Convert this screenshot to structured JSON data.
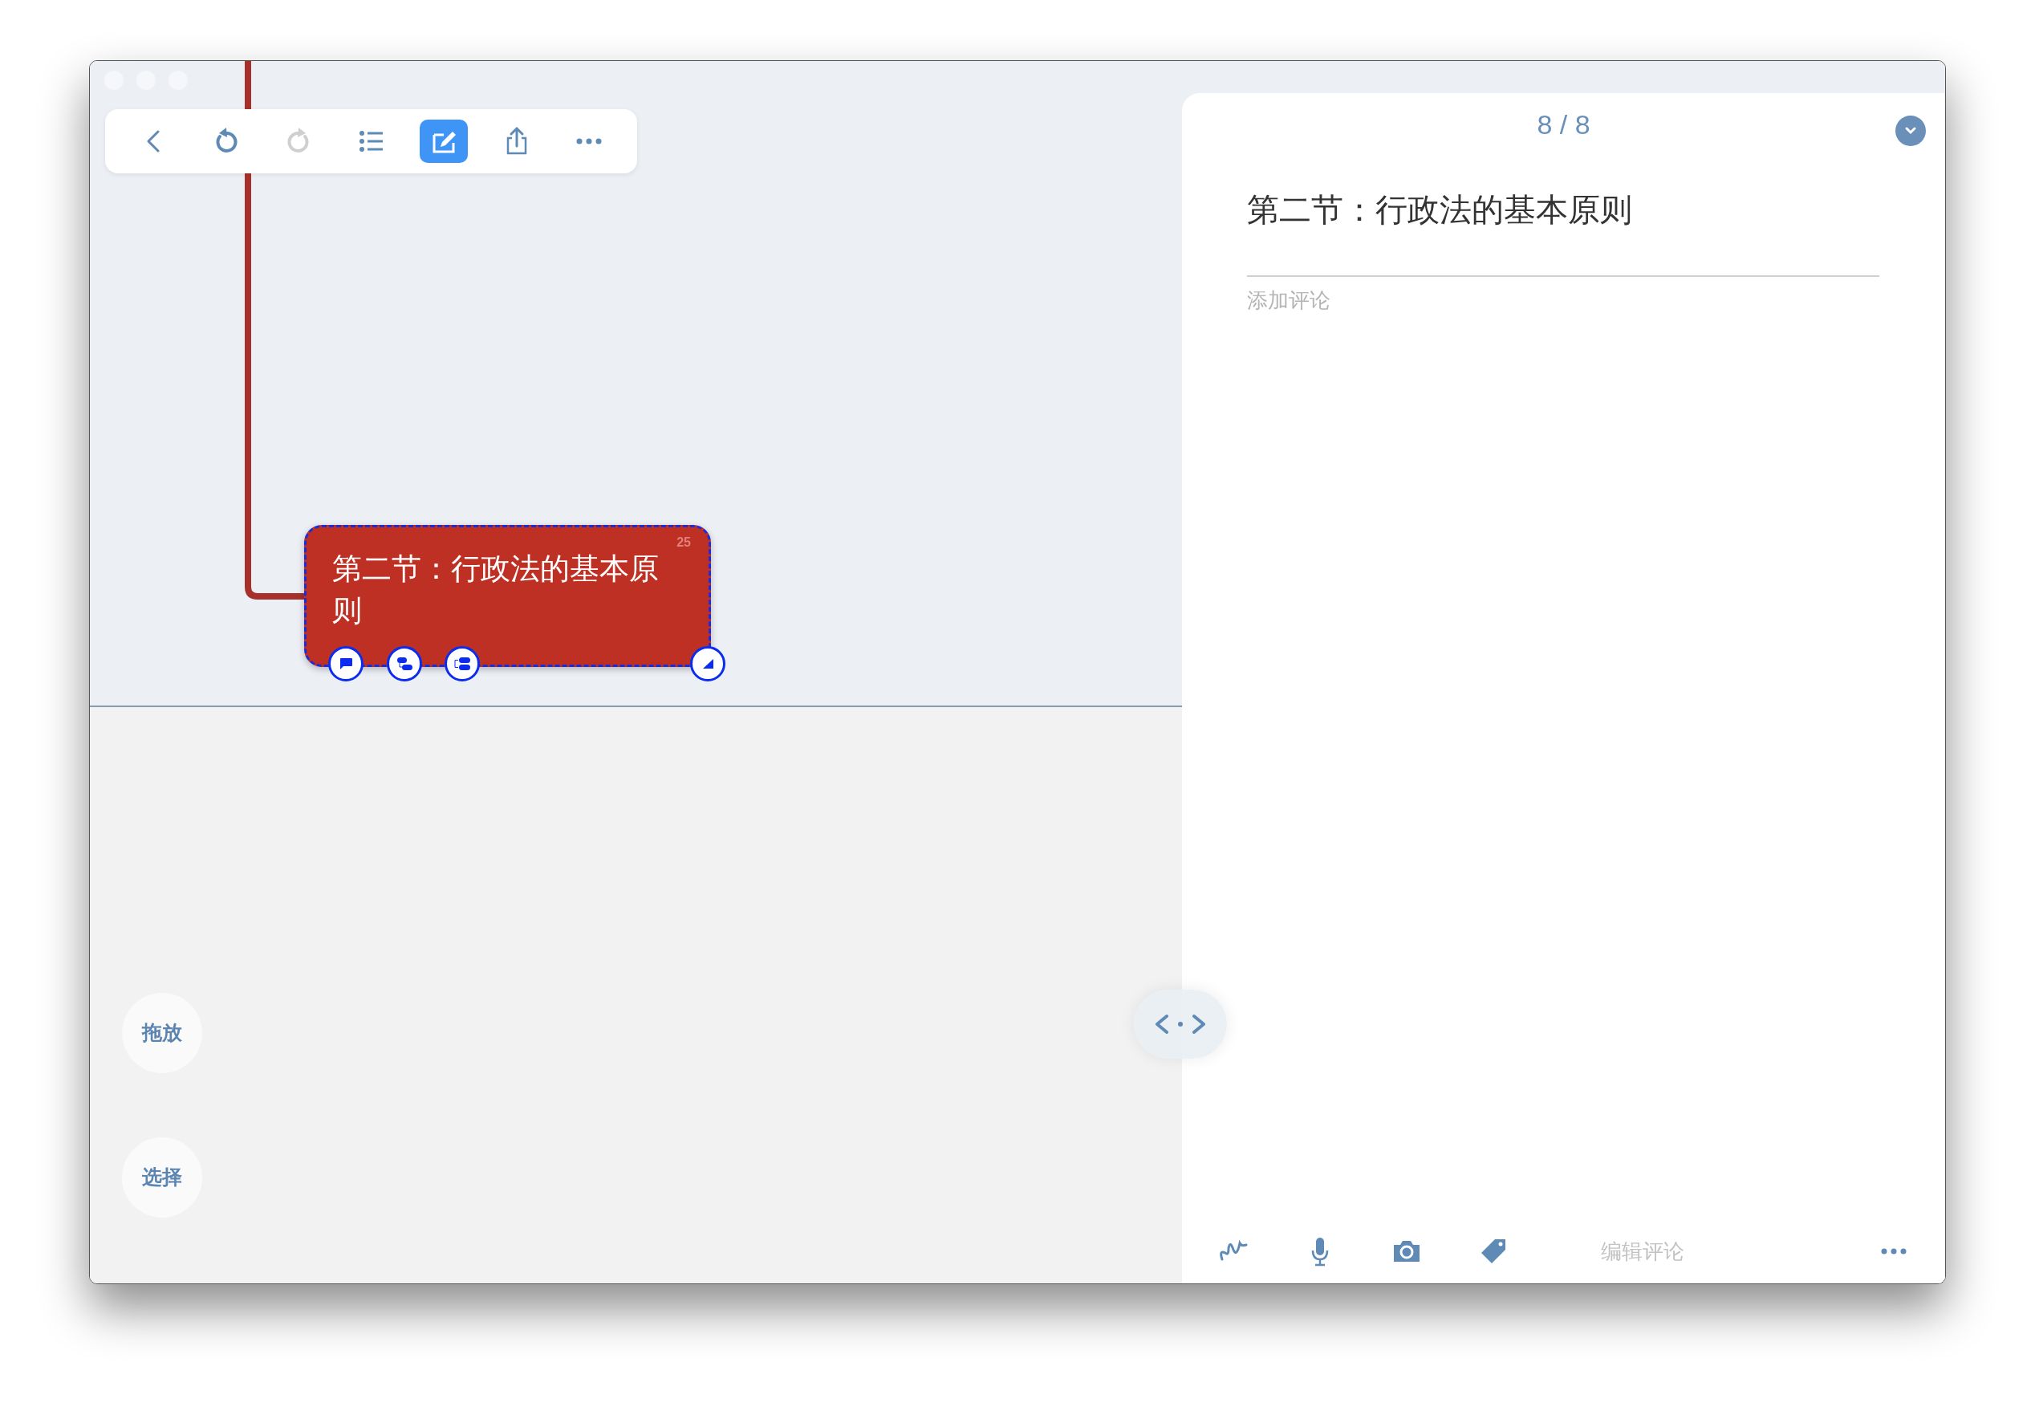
{
  "toolbar": [
    {
      "kind": "back",
      "selected": false,
      "disabled": false
    },
    {
      "kind": "undo",
      "selected": false,
      "disabled": false
    },
    {
      "kind": "redo",
      "selected": false,
      "disabled": true
    },
    {
      "kind": "outline",
      "selected": false,
      "disabled": false
    },
    {
      "kind": "edit",
      "selected": true,
      "disabled": false
    },
    {
      "kind": "share",
      "selected": false,
      "disabled": false
    },
    {
      "kind": "more",
      "selected": false,
      "disabled": false
    }
  ],
  "node": {
    "text": "第二节：行政法的基本原则",
    "count": "25",
    "selected": true,
    "actions": [
      {
        "kind": "comment"
      },
      {
        "kind": "subtopic"
      },
      {
        "kind": "sibling"
      },
      {
        "kind": "resize"
      }
    ]
  },
  "mode_buttons": [
    {
      "label": "拖放"
    },
    {
      "label": "选择"
    }
  ],
  "panel": {
    "counter": "8 / 8",
    "title": "第二节：行政法的基本原则",
    "comment_placeholder": "添加评论",
    "bottom_bar": {
      "tools": [
        {
          "kind": "draw"
        },
        {
          "kind": "mic"
        },
        {
          "kind": "camera"
        },
        {
          "kind": "tag"
        }
      ],
      "placeholder": "编辑评论"
    }
  }
}
